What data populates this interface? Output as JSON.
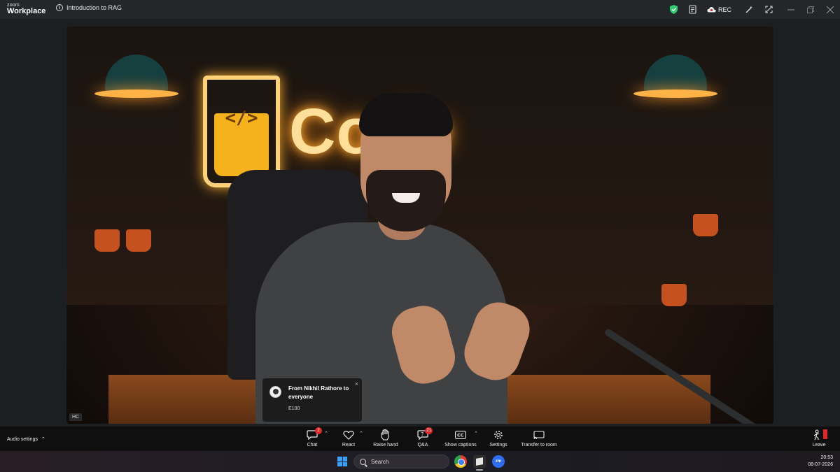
{
  "app": {
    "brand_top": "zoom",
    "brand_bottom": "Workplace",
    "meeting_title": "Introduction to RAG"
  },
  "title_bar": {
    "rec_label": "REC",
    "icons": [
      "shield-check-icon",
      "notes-icon",
      "cloud-rec-icon",
      "magic-wand-icon",
      "expand-icon",
      "minimize-icon",
      "restore-icon",
      "close-icon"
    ]
  },
  "video": {
    "participant_label": "HC",
    "background_text": "Code"
  },
  "chat_notification": {
    "from": "From Nikhil Rathore to everyone",
    "message": "E100",
    "close_glyph": "×"
  },
  "toolbar": {
    "audio_settings": "Audio settings",
    "buttons": [
      {
        "label": "Chat",
        "badge": "2"
      },
      {
        "label": "React",
        "badge": ""
      },
      {
        "label": "Raise hand",
        "badge": ""
      },
      {
        "label": "Q&A",
        "badge": "21"
      },
      {
        "label": "Show captions",
        "badge": ""
      },
      {
        "label": "Settings",
        "badge": ""
      },
      {
        "label": "Transfer to room",
        "badge": ""
      }
    ],
    "leave": "Leave"
  },
  "taskbar": {
    "search_placeholder": "Search",
    "zoom_app_label": "zm",
    "time": "20:53",
    "date": "08-07-2026"
  },
  "colors": {
    "badge_red": "#e02828",
    "neon": "#ffdf9a",
    "shield_green": "#2ecc71"
  }
}
